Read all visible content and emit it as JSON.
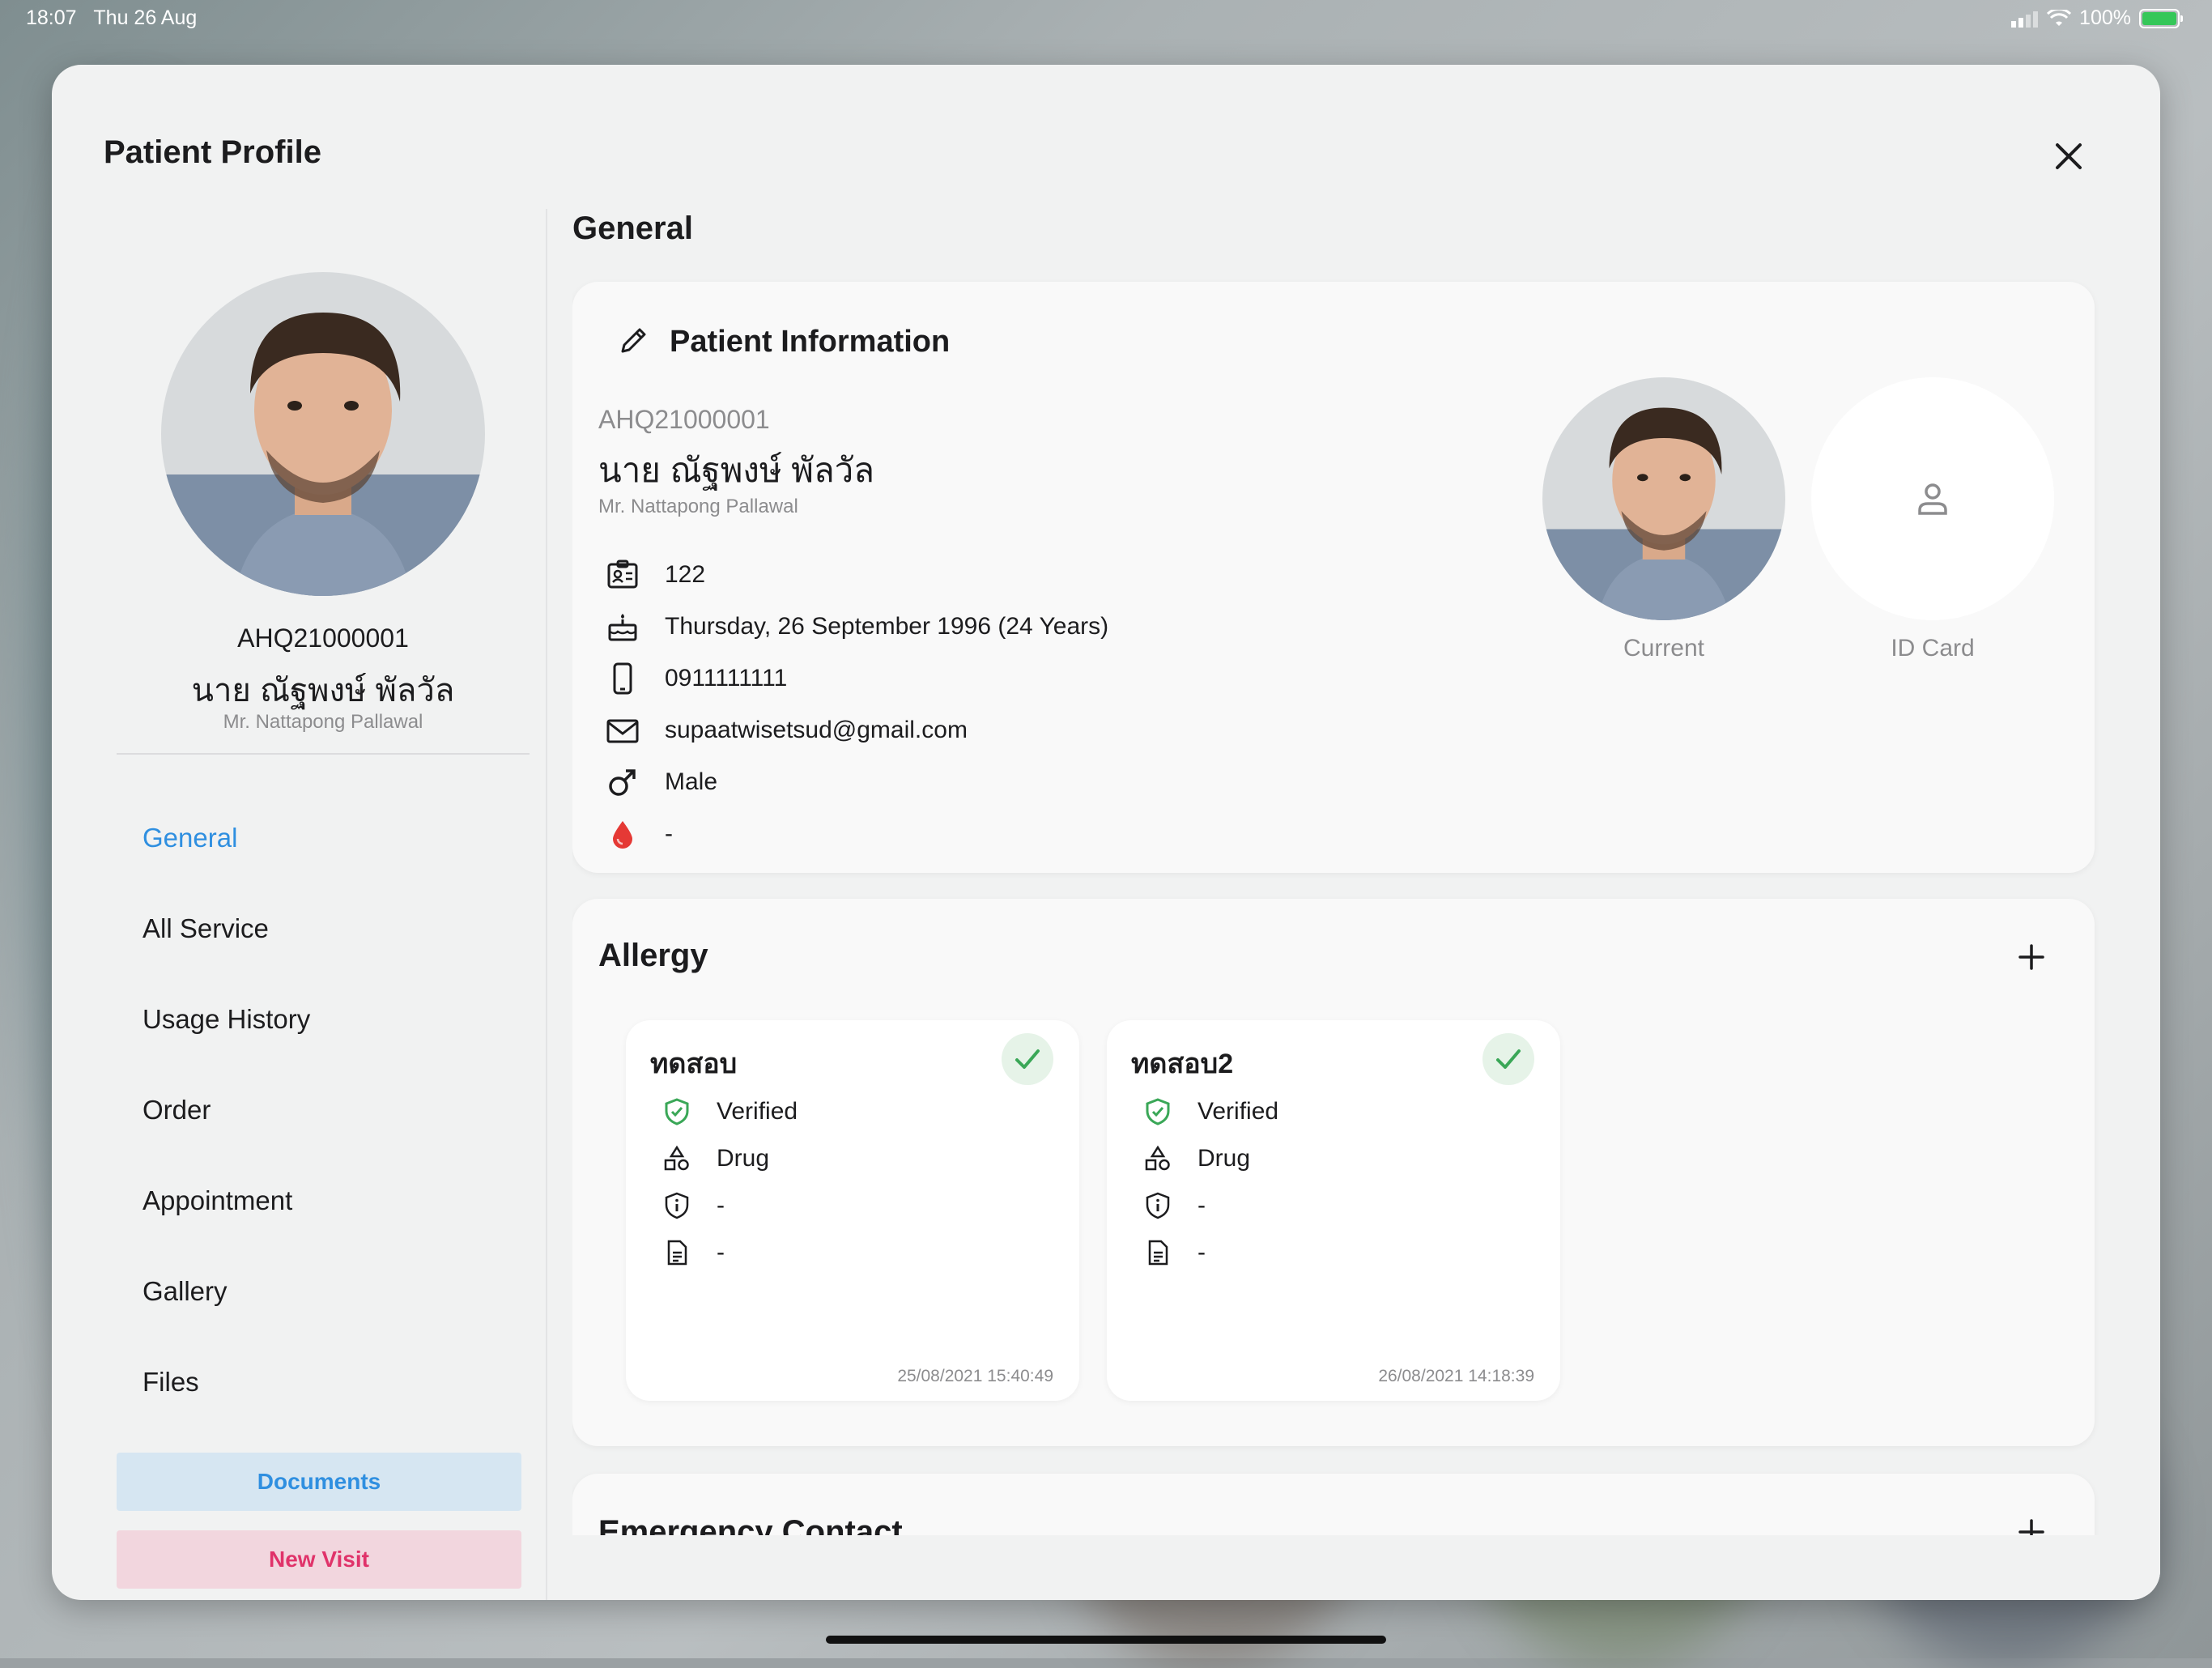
{
  "status_bar": {
    "time": "18:07",
    "date": "Thu 26 Aug",
    "battery": "100%"
  },
  "sheet": {
    "title": "Patient Profile"
  },
  "sidebar": {
    "code": "AHQ21000001",
    "name_th": "นาย ณัฐพงษ์ พัลวัล",
    "name_en": "Mr. Nattapong Pallawal",
    "nav": [
      {
        "label": "General",
        "active": true
      },
      {
        "label": "All Service"
      },
      {
        "label": "Usage History"
      },
      {
        "label": "Order"
      },
      {
        "label": "Appointment"
      },
      {
        "label": "Gallery"
      },
      {
        "label": "Files"
      }
    ],
    "documents_label": "Documents",
    "new_visit_label": "New Visit"
  },
  "main": {
    "title": "General",
    "patient_info": {
      "heading": "Patient Information",
      "code": "AHQ21000001",
      "name_th": "นาย ณัฐพงษ์ พัลวัล",
      "name_en": "Mr. Nattapong Pallawal",
      "id": "122",
      "birth": "Thursday, 26 September 1996 (24 Years)",
      "phone": "0911111111",
      "email": "supaatwisetsud@gmail.com",
      "gender": "Male",
      "blood": "-",
      "photo_current_label": "Current",
      "photo_id_label": "ID Card"
    },
    "allergy": {
      "title": "Allergy",
      "items": [
        {
          "name": "ทดสอบ",
          "status": "Verified",
          "type": "Drug",
          "severity": "-",
          "note": "-",
          "datetime": "25/08/2021 15:40:49"
        },
        {
          "name": "ทดสอบ2",
          "status": "Verified",
          "type": "Drug",
          "severity": "-",
          "note": "-",
          "datetime": "26/08/2021 14:18:39"
        }
      ]
    },
    "emergency": {
      "title": "Emergency Contact"
    }
  },
  "colors": {
    "accent_blue": "#2f8fe0",
    "accent_pink": "#e0336a",
    "verified_green": "#3aa757",
    "blood_red": "#e53935"
  }
}
